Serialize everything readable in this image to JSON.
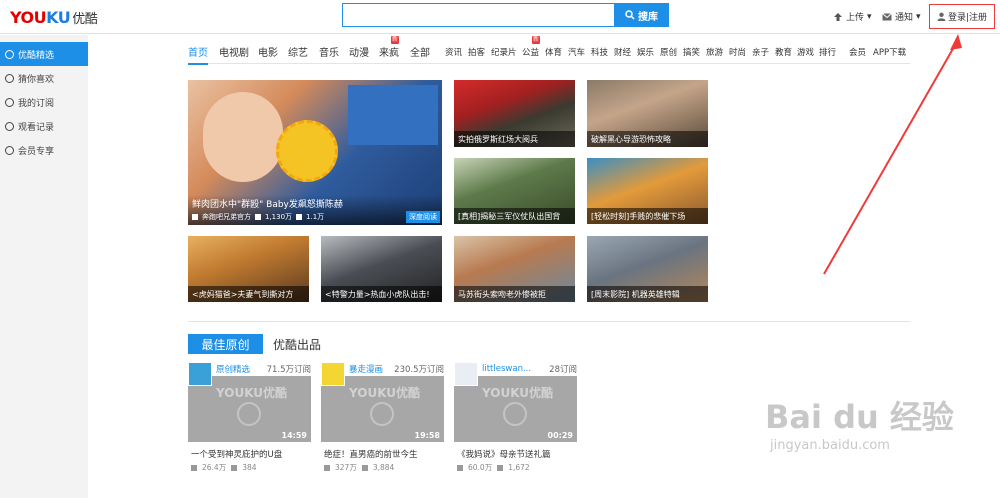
{
  "topbar": {
    "logo_main": "YOU",
    "logo_ku": "KU",
    "logo_cn": "优酷",
    "search_placeholder": "",
    "search_button": "搜库",
    "upload": "上传",
    "notify": "通知",
    "login": "登录|注册"
  },
  "sidebar": {
    "items": [
      {
        "label": "优酷精选",
        "active": true
      },
      {
        "label": "猜你喜欢",
        "active": false
      },
      {
        "label": "我的订阅",
        "active": false
      },
      {
        "label": "观看记录",
        "active": false
      },
      {
        "label": "会员专享",
        "active": false
      }
    ]
  },
  "nav": {
    "main": [
      "首页",
      "电视剧",
      "电影",
      "综艺",
      "音乐",
      "动漫",
      "来疯",
      "全部"
    ],
    "badges": {
      "laifeng": "新",
      "gongyi": "新"
    },
    "sub": [
      "资讯",
      "拍客",
      "纪录片",
      "公益",
      "体育",
      "汽车",
      "科技",
      "财经",
      "娱乐",
      "原创",
      "搞笑",
      "旅游",
      "时尚",
      "亲子",
      "教育",
      "游戏",
      "排行",
      "会员",
      "APP下载"
    ]
  },
  "feature": {
    "title": "鲜肉团水中\"群殴\" Baby发飙怒撕陈赫",
    "channel": "奔跑吧兄弟官方",
    "views": "1,130万",
    "comments": "1.1万",
    "tag": "深度阅读"
  },
  "tiles": [
    {
      "caption": "实拍俄罗斯红场大阅兵"
    },
    {
      "caption": "破解黑心导游恐怖攻略"
    },
    {
      "caption": "[真相]揭秘三军仪仗队出国背"
    },
    {
      "caption": "[轻松时刻]手贱的悲催下场"
    },
    {
      "caption": "<虎妈猫爸>夫妻气到撕对方"
    },
    {
      "caption": "<特警力量>热血小虎队出击!"
    },
    {
      "caption": "马苏街头索吻老外惨被拒"
    },
    {
      "caption": "[周末影院] 机器英雄特辑"
    }
  ],
  "section": {
    "tab_active": "最佳原创",
    "tab_other": "优酷出品"
  },
  "cards": [
    {
      "channel": "原创精选",
      "subs": "71.5万订阅",
      "duration": "14:59",
      "title": "一个受到神灵庇护的U盘",
      "views": "26.4万",
      "comments": "384",
      "watermark": "YOUKU优酷"
    },
    {
      "channel": "暴走漫画",
      "subs": "230.5万订阅",
      "duration": "19:58",
      "title": "绝症！直男癌的前世今生",
      "views": "327万",
      "comments": "3,884",
      "watermark": "YOUKU优酷"
    },
    {
      "channel": "littleswan...",
      "subs": "28订阅",
      "duration": "00:29",
      "title": "《我妈说》母亲节送礼篇",
      "views": "60.0万",
      "comments": "1,672",
      "watermark": "YOUKU优酷"
    }
  ],
  "watermark": {
    "main": "Bai du 经验",
    "url": "jingyan.baidu.com"
  },
  "colors": {
    "accent": "#1e8fe6",
    "brand_red": "#e50000",
    "arrow": "#f03a3a"
  }
}
